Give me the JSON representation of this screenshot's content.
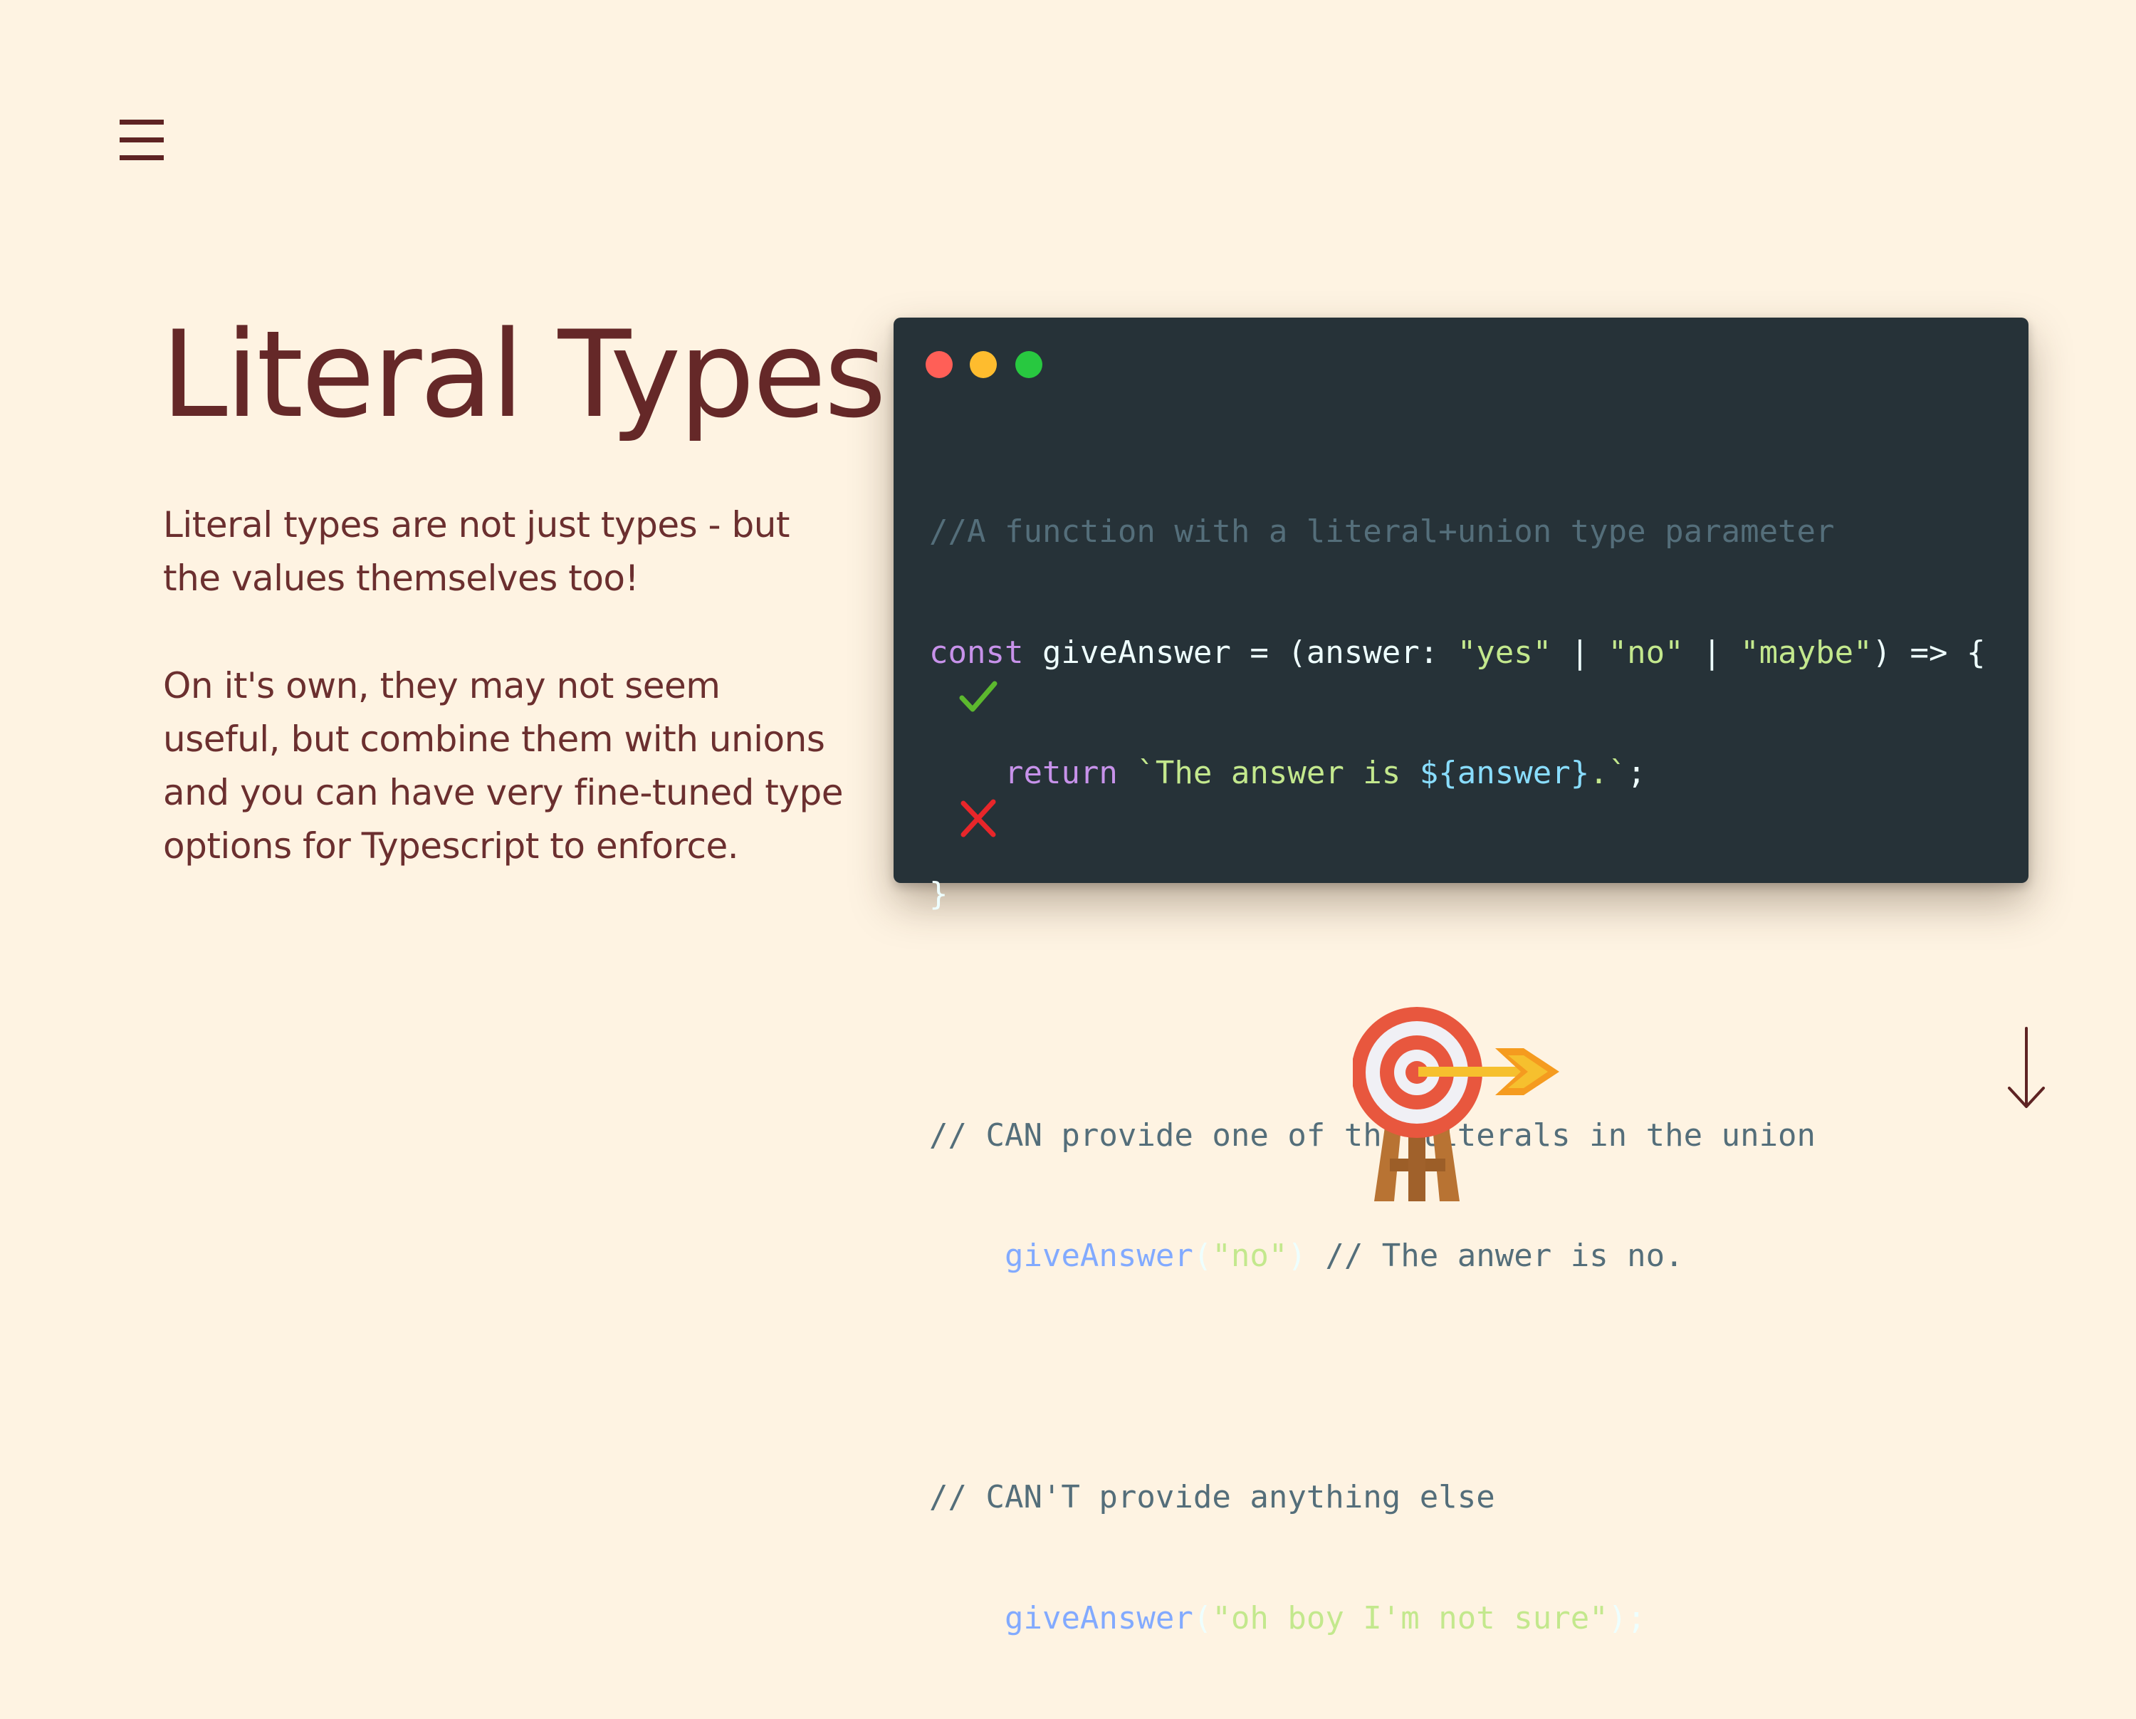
{
  "nav": {
    "menu_icon": "hamburger-menu-icon"
  },
  "hero": {
    "title": "Literal Types",
    "paragraph_1": "Literal types are not just types - but the values themselves too!",
    "paragraph_2": "On it's own, they may not seem useful, but combine them with unions and you can have very fine-tuned type options for Typescript to enforce."
  },
  "code_window": {
    "controls": [
      "close-dot",
      "minimize-dot",
      "maximize-dot"
    ],
    "colors": {
      "background": "#263238",
      "close": "#ff5f57",
      "minimize": "#febc2e",
      "maximize": "#28c840"
    },
    "line_1": "//A function with a literal+union type parameter",
    "line_2": {
      "kw": "const",
      "rest": " giveAnswer = (answer: ",
      "s1": "\"yes\"",
      "sep1": " | ",
      "s2": "\"no\"",
      "sep2": " | ",
      "s3": "\"maybe\"",
      "tail": ") => {"
    },
    "line_3": {
      "indent": "    ",
      "kw": "return",
      "space": " ",
      "tpl_start": "`The answer is ",
      "tpl_expr": "${answer}",
      "tpl_end": ".`",
      "semi": ";"
    },
    "line_4": "}",
    "line_6": "// CAN provide one of the literals in the union",
    "line_7": {
      "indent": "    ",
      "fn": "giveAnswer",
      "open": "(",
      "arg": "\"no\"",
      "close": ")",
      "comment": " // The anwer is no."
    },
    "line_9": "// CAN'T provide anything else",
    "line_10": {
      "indent": "    ",
      "fn": "giveAnswer",
      "open": "(",
      "arg": "\"oh boy I'm not sure\"",
      "close": ");"
    },
    "valid_icon": "check-icon",
    "invalid_icon": "cross-icon"
  },
  "decor": {
    "illustration": "target-with-arrow-icon",
    "scroll_icon": "arrow-down-icon"
  },
  "colors": {
    "page_bg": "#fef3e2",
    "title": "#652828",
    "text": "#6b2f2f"
  }
}
